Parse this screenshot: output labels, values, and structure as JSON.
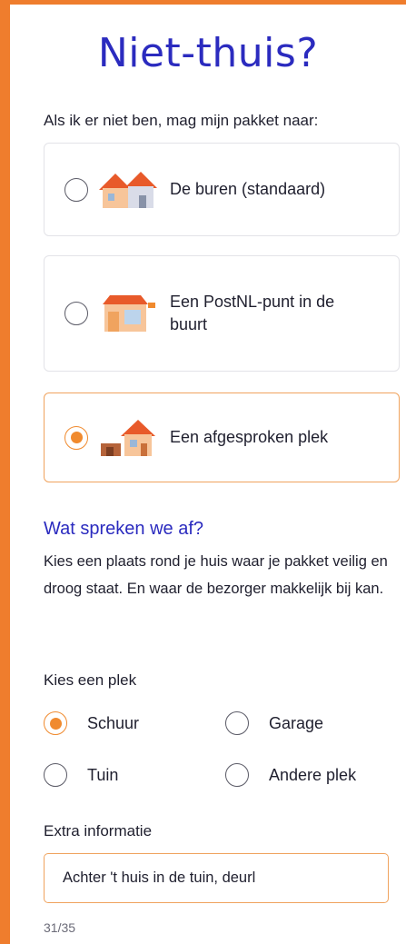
{
  "page": {
    "title": "Niet-thuis?",
    "intro": "Als ik er niet ben, mag mijn pakket naar:"
  },
  "options": [
    {
      "label": "De buren (standaard)",
      "selected": false,
      "icon": "houses-icon"
    },
    {
      "label": "Een PostNL-punt in de buurt",
      "selected": false,
      "icon": "shop-icon"
    },
    {
      "label": "Een afgesproken plek",
      "selected": true,
      "icon": "house-shed-icon"
    }
  ],
  "agreement": {
    "title": "Wat spreken we af?",
    "text": "Kies een plaats rond je huis waar je pakket veilig en droog staat. En waar de bezorger makkelijk bij kan."
  },
  "place": {
    "label": "Kies een plek",
    "choices": [
      {
        "label": "Schuur",
        "selected": true
      },
      {
        "label": "Garage",
        "selected": false
      },
      {
        "label": "Tuin",
        "selected": false
      },
      {
        "label": "Andere plek",
        "selected": false
      }
    ]
  },
  "extra": {
    "label": "Extra informatie",
    "value": "Achter 't huis in de tuin, deurl",
    "counter": "31/35"
  },
  "colors": {
    "accent": "#ef7d2d",
    "title": "#2b2bbf",
    "border": "#e3e3e8"
  }
}
